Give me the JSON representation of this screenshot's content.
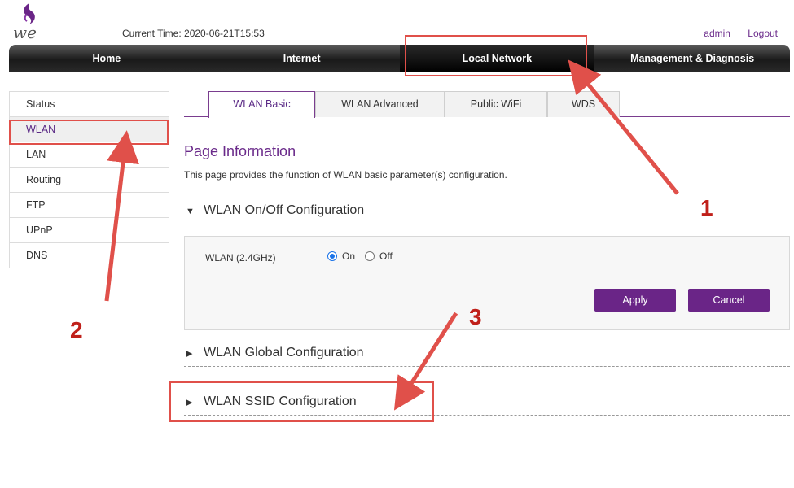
{
  "header": {
    "logo_text": "we",
    "current_time_label": "Current Time: 2020-06-21T15:53",
    "user": "admin",
    "logout": "Logout"
  },
  "nav": {
    "items": [
      {
        "label": "Home"
      },
      {
        "label": "Internet"
      },
      {
        "label": "Local Network"
      },
      {
        "label": "Management & Diagnosis"
      }
    ],
    "active": "Local Network"
  },
  "sidebar": {
    "items": [
      {
        "label": "Status"
      },
      {
        "label": "WLAN"
      },
      {
        "label": "LAN"
      },
      {
        "label": "Routing"
      },
      {
        "label": "FTP"
      },
      {
        "label": "UPnP"
      },
      {
        "label": "DNS"
      }
    ],
    "active": "WLAN"
  },
  "tabs": {
    "items": [
      {
        "label": "WLAN Basic"
      },
      {
        "label": "WLAN Advanced"
      },
      {
        "label": "Public WiFi"
      },
      {
        "label": "WDS"
      }
    ],
    "active": "WLAN Basic"
  },
  "page": {
    "title": "Page Information",
    "description": "This page provides the function of WLAN basic parameter(s) configuration."
  },
  "sections": {
    "onoff": {
      "title": "WLAN On/Off Configuration",
      "expanded": true,
      "field_label": "WLAN (2.4GHz)",
      "options": [
        "On",
        "Off"
      ],
      "selected": "On",
      "apply": "Apply",
      "cancel": "Cancel"
    },
    "global": {
      "title": "WLAN Global Configuration",
      "expanded": false
    },
    "ssid": {
      "title": "WLAN SSID Configuration",
      "expanded": false
    }
  },
  "annotations": {
    "one": "1",
    "two": "2",
    "three": "3"
  },
  "colors": {
    "accent": "#6a2587",
    "annotation": "#e0504a",
    "annotation_number": "#c0201a"
  }
}
